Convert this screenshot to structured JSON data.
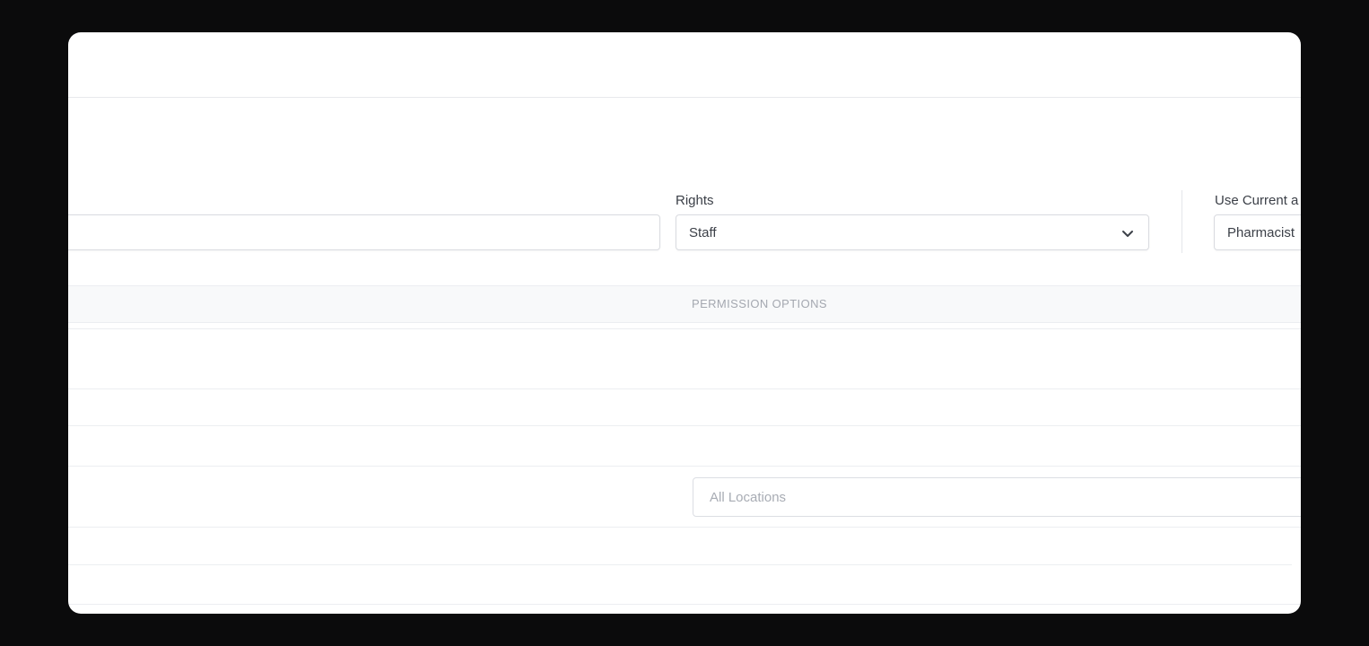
{
  "form": {
    "rights_label": "Rights",
    "rights_value": "Staff",
    "use_current_label": "Use Current a",
    "use_current_value": "Pharmacist"
  },
  "table": {
    "column_header": "PERMISSION OPTIONS",
    "location_placeholder": "All Locations"
  },
  "icons": {
    "dropdown": "chevron-down-icon"
  },
  "colors": {
    "backdrop": "#0b0b0c",
    "panel": "#ffffff",
    "border": "#d9dbe0",
    "header_bg": "#f8f9fa"
  }
}
